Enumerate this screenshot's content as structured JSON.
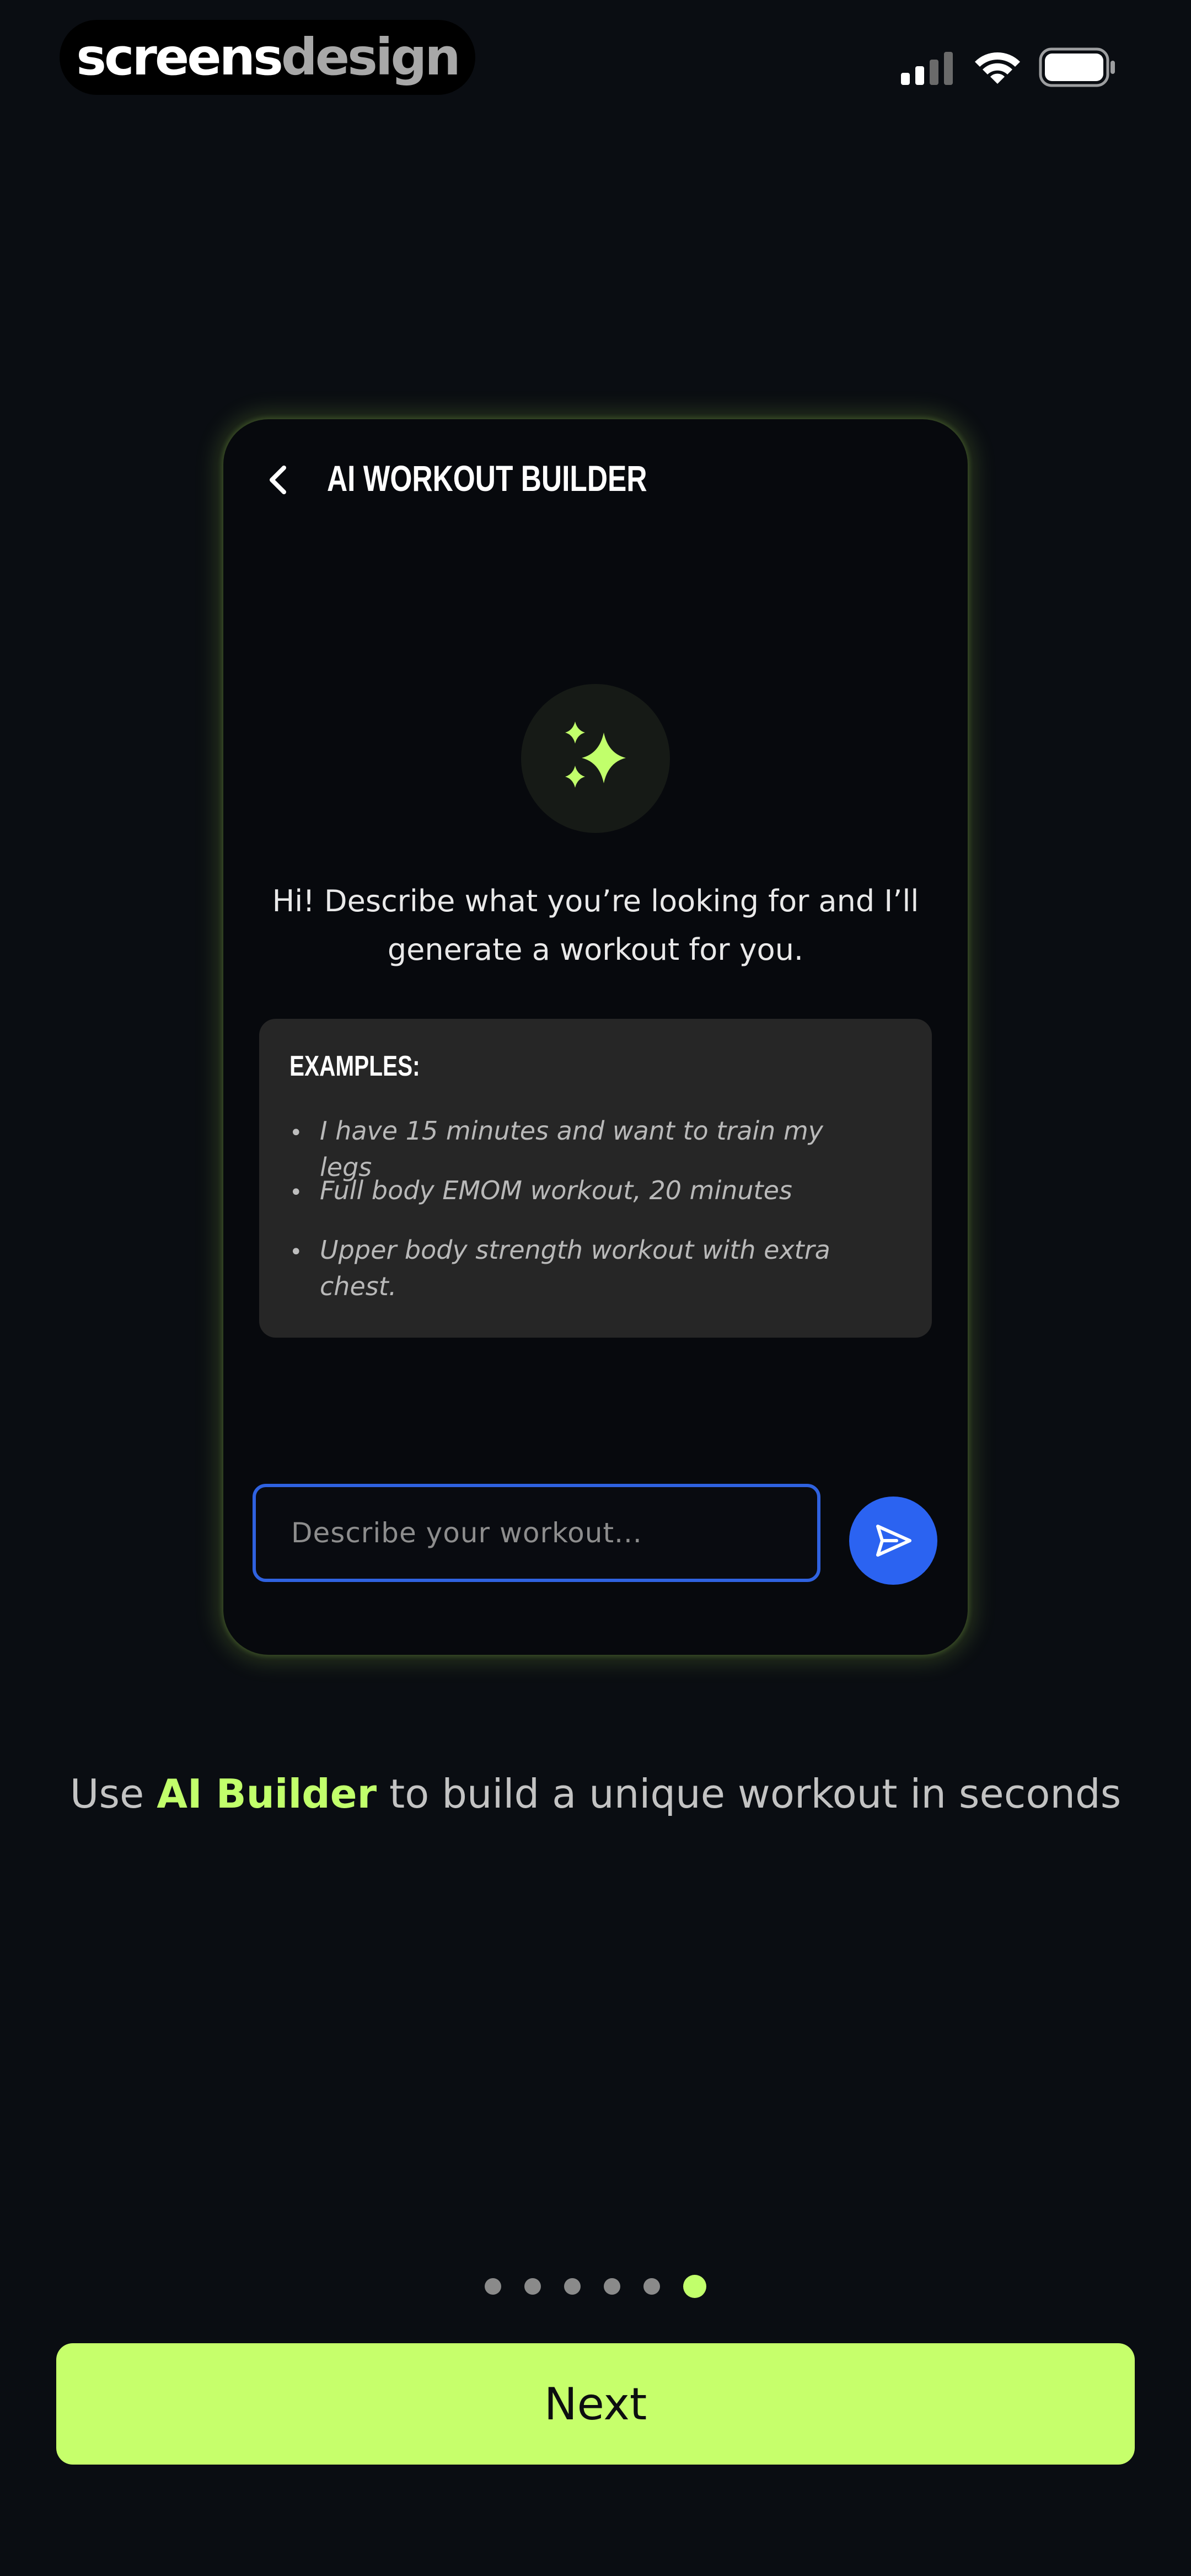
{
  "status_bar": {
    "brand_part1": "screens",
    "brand_part2": "design",
    "signal_icon": "signal-icon",
    "wifi_icon": "wifi-icon",
    "battery_icon": "battery-icon"
  },
  "card": {
    "back_icon": "chevron-left-icon",
    "title": "AI WORKOUT BUILDER",
    "sparkle_icon": "sparkle-icon",
    "greeting": "Hi! Describe what you’re looking for and I’ll generate a workout for you.",
    "examples_title": "EXAMPLES:",
    "examples": [
      "I have 15 minutes and want to train my legs",
      "Full body EMOM workout, 20 minutes",
      "Upper body strength workout with extra chest."
    ],
    "input_placeholder": "Describe your workout...",
    "send_icon": "send-icon"
  },
  "caption": {
    "prefix": "Use ",
    "highlight": "AI Builder",
    "suffix": " to build a unique workout in seconds"
  },
  "pager": {
    "total": 6,
    "active": 6
  },
  "next_label": "Next",
  "colors": {
    "accent": "#c1ff6b",
    "primary_blue": "#2b63f1",
    "background": "#0a0d12"
  }
}
